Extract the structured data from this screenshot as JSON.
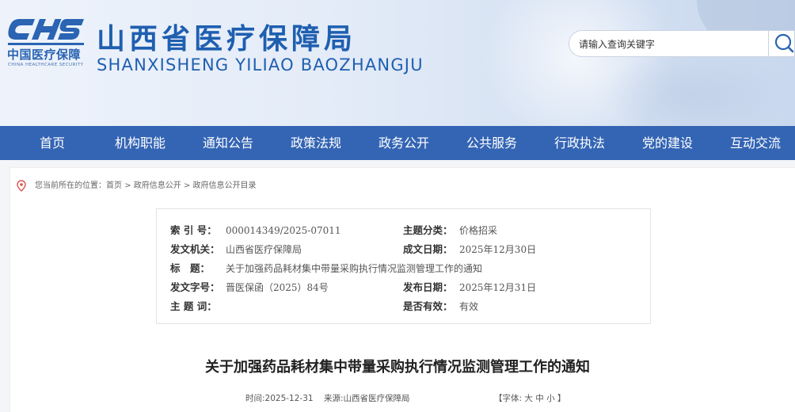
{
  "header": {
    "logo_cn": "中国医疗保障",
    "logo_en": "CHINA HEALTHCARE SECURITY",
    "logo_mark": "CHS",
    "site_title": "山西省医疗保障局",
    "site_subtitle": "SHANXISHENG YILIAO BAOZHANGJU",
    "brand_color": "#1f5fb0"
  },
  "search": {
    "placeholder": "请输入查询关键字",
    "icon": "search-icon"
  },
  "nav": {
    "background": "#3465b4",
    "items": [
      {
        "label": "首页"
      },
      {
        "label": "机构职能"
      },
      {
        "label": "通知公告"
      },
      {
        "label": "政策法规"
      },
      {
        "label": "政务公开"
      },
      {
        "label": "公共服务"
      },
      {
        "label": "行政执法"
      },
      {
        "label": "党的建设"
      },
      {
        "label": "互动交流"
      }
    ]
  },
  "breadcrumb": {
    "icon": "location-pin-icon",
    "prefix": "您当前所在的位置：",
    "items": [
      "首页",
      "政府信息公开",
      "政府信息公开目录"
    ],
    "separator": ">"
  },
  "info": {
    "index_label": "索 引 号：",
    "index_value": "000014349/2025-07011",
    "topic_label": "主题分类：",
    "topic_value": "价格招采",
    "issuer_label": "发文机关：",
    "issuer_value": "山西省医疗保障局",
    "created_label": "成文日期：",
    "created_value": "2025年12月30日",
    "title_label": "标　题：",
    "title_value": "关于加强药品耗材集中带量采购执行情况监测管理工作的通知",
    "docno_label": "发文字号：",
    "docno_value": "晋医保函（2025）84号",
    "published_label": "发布日期：",
    "published_value": "2025年12月31日",
    "keywords_label": "主 题 词：",
    "keywords_value": "",
    "valid_label": "是否有效：",
    "valid_value": "有效"
  },
  "document": {
    "title": "关于加强药品耗材集中带量采购执行情况监测管理工作的通知",
    "time": "时间:2025-12-31",
    "source": "来源:山西省医疗保障局",
    "font_prefix": "【字体:",
    "font_large": "大",
    "font_medium": "中",
    "font_small": "小",
    "font_suffix": "】"
  }
}
